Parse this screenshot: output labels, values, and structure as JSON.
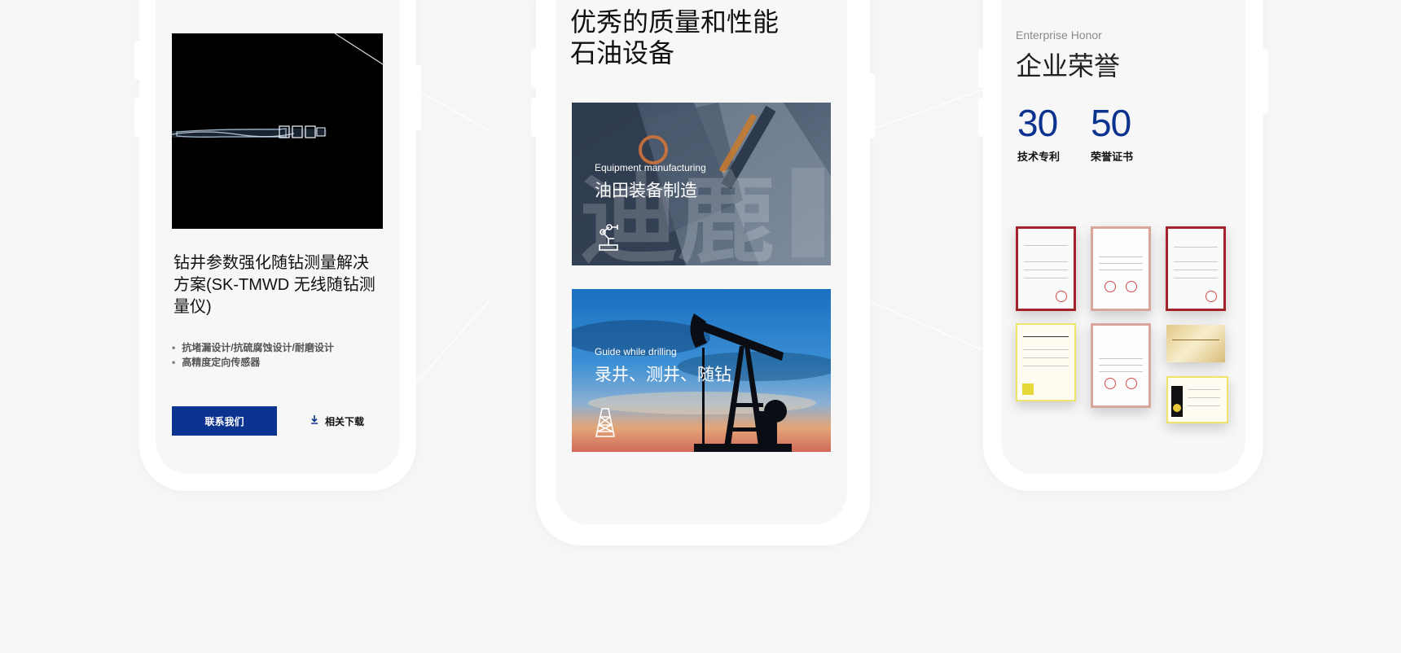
{
  "product": {
    "title": "钻井参数强化随钻测量解决方案(SK-TMWD 无线随钻测量仪)",
    "bullets": [
      "抗堵漏设计/抗硫腐蚀设计/耐磨设计",
      "高精度定向传感器"
    ],
    "contact_label": "联系我们",
    "download_label": "相关下载",
    "download_icon": "download-icon"
  },
  "equipment": {
    "title_line1": "优秀的质量和性能",
    "title_line2": "石油设备",
    "cards": [
      {
        "en": "Equipment manufacturing",
        "zh": "油田装备制造",
        "icon": "robot-arm-icon"
      },
      {
        "en": "Guide while drilling",
        "zh": "录井、测井、随钻",
        "icon": "oil-derrick-icon"
      }
    ]
  },
  "honor": {
    "subtitle": "Enterprise Honor",
    "title": "企业荣誉",
    "stats": [
      {
        "num": "30",
        "label": "技术专利"
      },
      {
        "num": "50",
        "label": "荣誉证书"
      }
    ]
  },
  "colors": {
    "brand_blue": "#0d3390",
    "background": "#f6f6f6",
    "screen": "#f7f7f7"
  }
}
